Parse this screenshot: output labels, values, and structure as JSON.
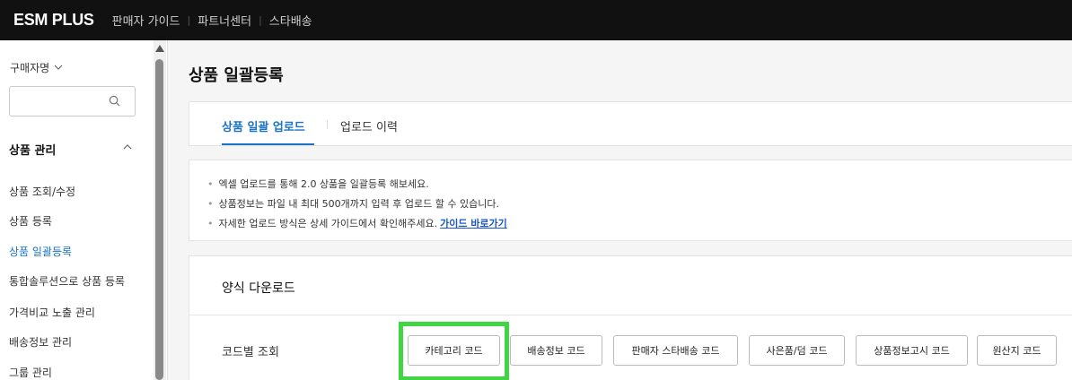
{
  "topbar": {
    "logo": "ESM PLUS",
    "nav": [
      "판매자 가이드",
      "파트너센터",
      "스타배송"
    ],
    "separator": "|"
  },
  "sidebar": {
    "seller_select": "구매자명",
    "search_placeholder": "",
    "menu_header": "상품 관리",
    "items": [
      {
        "label": "상품 조회/수정",
        "active": false
      },
      {
        "label": "상품 등록",
        "active": false
      },
      {
        "label": "상품 일괄등록",
        "active": true
      },
      {
        "label": "통합솔루션으로 상품 등록",
        "active": false
      },
      {
        "label": "가격비교 노출 관리",
        "active": false
      },
      {
        "label": "배송정보 관리",
        "active": false
      },
      {
        "label": "그룹 관리",
        "active": false
      }
    ]
  },
  "main": {
    "title": "상품 일괄등록",
    "tabs": [
      {
        "label": "상품 일괄 업로드",
        "active": true
      },
      {
        "label": "업로드 이력",
        "active": false
      }
    ],
    "notices": [
      "엑셀 업로드를 통해 2.0 상품을 일괄등록 해보세요.",
      "상품정보는 파일 내 최대 500개까지 입력 후 업로드 할 수 있습니다.",
      "자세한 업로드 방식은 상세 가이드에서 확인해주세요."
    ],
    "guide_link": "가이드 바로가기",
    "download": {
      "title": "양식 다운로드",
      "code_label": "코드별 조회",
      "buttons": [
        "카테고리 코드",
        "배송정보 코드",
        "판매자 스타배송 코드",
        "사은품/덤 코드",
        "상품정보고시 코드",
        "원산지 코드"
      ]
    }
  },
  "colors": {
    "accent": "#1a73c8",
    "highlight": "#3fd543",
    "topbar": "#111111"
  }
}
